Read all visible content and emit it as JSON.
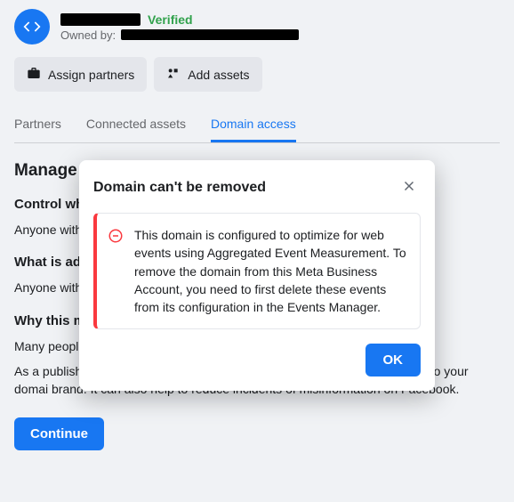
{
  "header": {
    "verified_label": "Verified",
    "owned_by_label": "Owned by:"
  },
  "actions": {
    "assign_partners": "Assign partners",
    "add_assets": "Add assets"
  },
  "tabs": {
    "partners": "Partners",
    "connected_assets": "Connected assets",
    "domain_access": "Domain access"
  },
  "content": {
    "title": "Manage ad link editing",
    "h1": "Control whi",
    "p1": "Anyone with                                                                                                                                                  main.",
    "h2": "What is ad",
    "p2": "Anyone with                                                                                                                                                  main. By def title, descript",
    "h3": "Why this m",
    "p3": "Many people                                                                                                                                                  it can also l resulting in d",
    "p4": "As a publisher of online content, you can apply limits to the way people link to your domai brand. It can also help to reduce incidents of misinformation on Facebook.",
    "continue": "Continue"
  },
  "modal": {
    "title": "Domain can't be removed",
    "body": "This domain is configured to optimize for web events using Aggregated Event Measurement. To remove the domain from this Meta Business Account, you need to first delete these events from its configuration in the Events Manager.",
    "ok": "OK"
  }
}
